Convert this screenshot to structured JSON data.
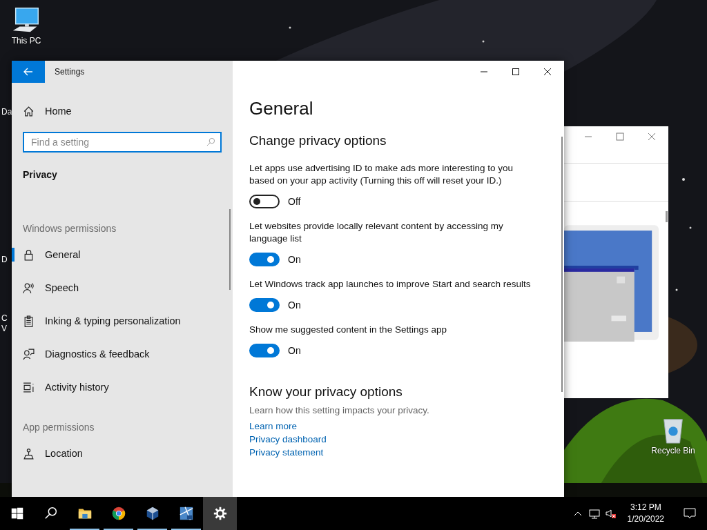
{
  "desktop": {
    "icons": [
      {
        "kind": "pc",
        "label": "This PC"
      },
      {
        "kind": "bin",
        "label": "Recycle Bin"
      }
    ],
    "hidden_labels": [
      {
        "text": "Da"
      },
      {
        "text": "D"
      },
      {
        "text": "C"
      },
      {
        "text": "V"
      }
    ]
  },
  "settings_window": {
    "title": "Settings",
    "sidebar": {
      "home": "Home",
      "search": {
        "placeholder": "Find a setting"
      },
      "section": "Privacy",
      "groups": [
        {
          "heading": "Windows permissions",
          "items": [
            {
              "label": "General",
              "kind": "lock",
              "selected": true
            },
            {
              "label": "Speech",
              "kind": "speech",
              "selected": false
            },
            {
              "label": "Inking & typing personalization",
              "kind": "clipboard",
              "selected": false
            },
            {
              "label": "Diagnostics & feedback",
              "kind": "feedback",
              "selected": false
            },
            {
              "label": "Activity history",
              "kind": "activity",
              "selected": false
            }
          ]
        },
        {
          "heading": "App permissions",
          "items": [
            {
              "label": "Location",
              "kind": "location",
              "selected": false
            }
          ]
        }
      ]
    },
    "page": {
      "title": "General",
      "subtitle": "Change privacy options",
      "options": [
        {
          "label": "Let apps use advertising ID to make ads more interesting to you based on your app activity (Turning this off will reset your ID.)",
          "on": false,
          "state_label": "Off"
        },
        {
          "label": "Let websites provide locally relevant content by accessing my language list",
          "on": true,
          "state_label": "On"
        },
        {
          "label": "Let Windows track app launches to improve Start and search results",
          "on": true,
          "state_label": "On"
        },
        {
          "label": "Show me suggested content in the Settings app",
          "on": true,
          "state_label": "On"
        }
      ],
      "know_heading": "Know your privacy options",
      "know_text": "Learn how this setting impacts your privacy.",
      "links": [
        "Learn more",
        "Privacy dashboard",
        "Privacy statement"
      ]
    }
  },
  "taskbar": {
    "apps": [
      {
        "kind": "start",
        "running": false,
        "selected": false
      },
      {
        "kind": "search",
        "running": false,
        "selected": false
      },
      {
        "kind": "explorer",
        "running": true,
        "selected": false
      },
      {
        "kind": "chrome",
        "running": true,
        "selected": false
      },
      {
        "kind": "cube",
        "running": true,
        "selected": false
      },
      {
        "kind": "xp",
        "running": true,
        "selected": false
      },
      {
        "kind": "settings",
        "running": false,
        "selected": true
      }
    ],
    "time": "3:12 PM",
    "date": "1/20/2022"
  }
}
